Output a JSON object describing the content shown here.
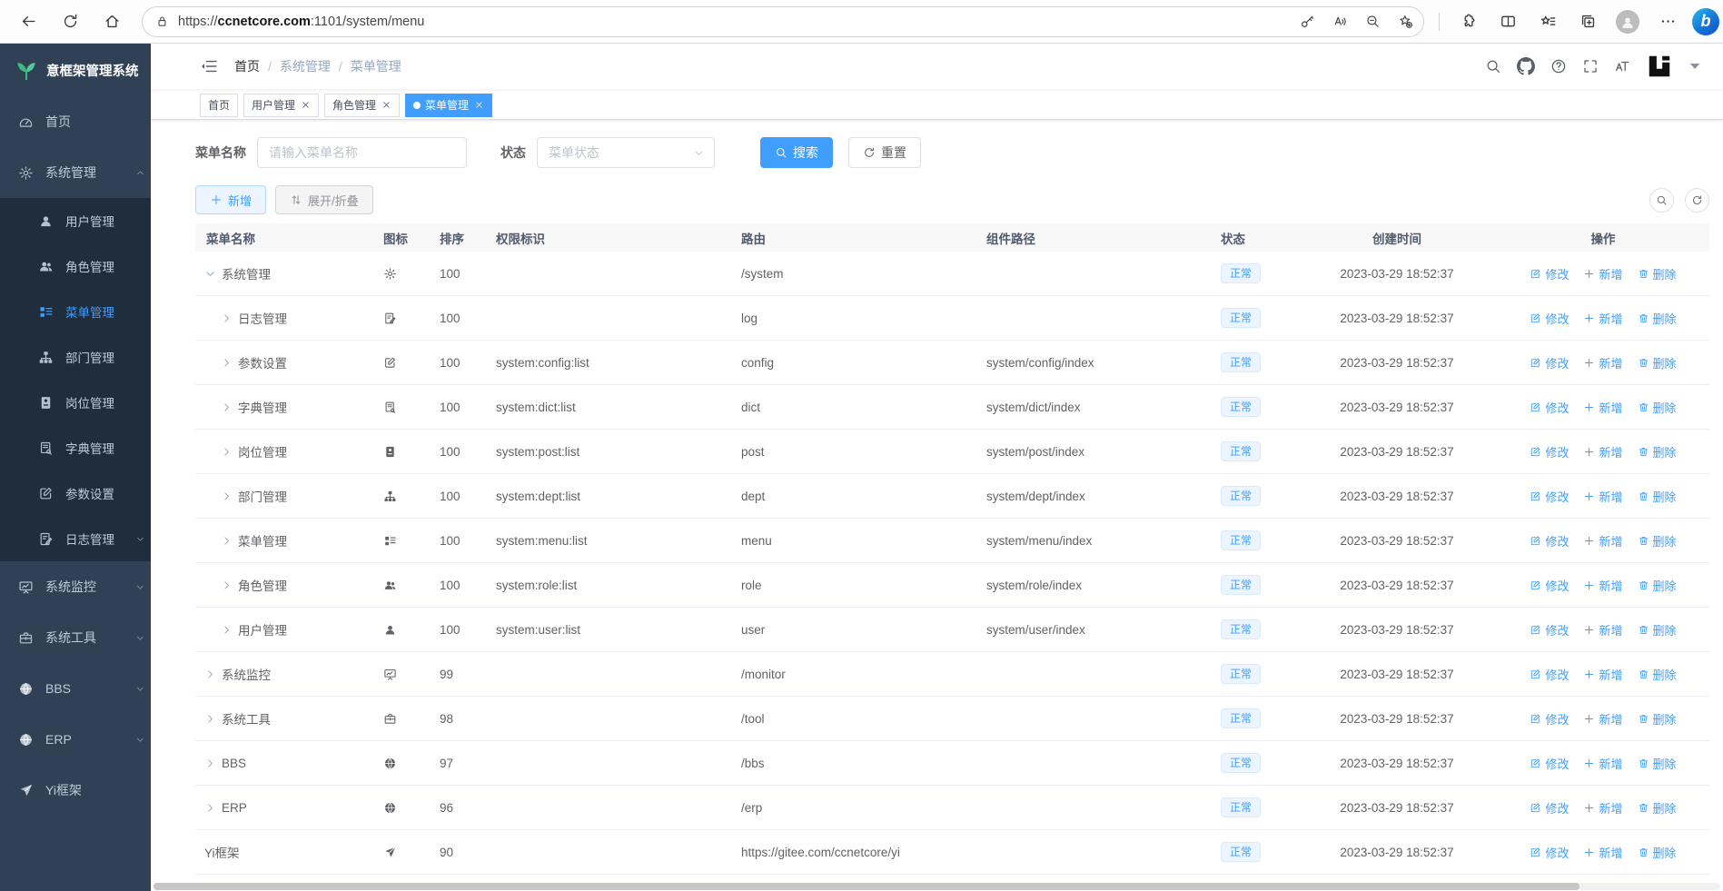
{
  "browser": {
    "url_scheme": "https://",
    "url_domain": "ccnetcore.com",
    "url_rest": ":1101/system/menu",
    "bing_label": "b"
  },
  "app": {
    "logo_text": "意框架管理系统"
  },
  "colors": {
    "accent": "#409eff",
    "sidebar_bg": "#304156",
    "sidebar_submenu_bg": "#1f2d3d",
    "active_tab_bg": "#409eff",
    "status_badge_bg": "#ecf5ff",
    "logo_green": "#3eb983"
  },
  "sidebar": {
    "items": [
      {
        "key": "home",
        "label": "首页",
        "icon": "dashboard-icon",
        "level": 0
      },
      {
        "key": "system",
        "label": "系统管理",
        "icon": "gear-icon",
        "level": 0,
        "arrow": "up"
      },
      {
        "key": "user",
        "label": "用户管理",
        "icon": "user-icon",
        "level": 1
      },
      {
        "key": "role",
        "label": "角色管理",
        "icon": "users-icon",
        "level": 1
      },
      {
        "key": "menu",
        "label": "菜单管理",
        "icon": "menu-list-icon",
        "level": 1,
        "active": true
      },
      {
        "key": "dept",
        "label": "部门管理",
        "icon": "org-tree-icon",
        "level": 1
      },
      {
        "key": "post",
        "label": "岗位管理",
        "icon": "id-badge-icon",
        "level": 1
      },
      {
        "key": "dict",
        "label": "字典管理",
        "icon": "dict-book-icon",
        "level": 1
      },
      {
        "key": "config",
        "label": "参数设置",
        "icon": "edit-square-icon",
        "level": 1
      },
      {
        "key": "log",
        "label": "日志管理",
        "icon": "log-doc-icon",
        "level": 1,
        "arrow": "down"
      },
      {
        "key": "monitor",
        "label": "系统监控",
        "icon": "monitor-icon",
        "level": 0,
        "arrow": "down"
      },
      {
        "key": "tool",
        "label": "系统工具",
        "icon": "toolbox-icon",
        "level": 0,
        "arrow": "down"
      },
      {
        "key": "bbs",
        "label": "BBS",
        "icon": "globe-icon",
        "level": 0,
        "arrow": "down"
      },
      {
        "key": "erp",
        "label": "ERP",
        "icon": "globe-icon",
        "level": 0,
        "arrow": "down"
      },
      {
        "key": "yi",
        "label": "Yi框架",
        "icon": "paper-plane-icon",
        "level": 0
      }
    ]
  },
  "breadcrumb": {
    "separator": "/",
    "items": [
      {
        "key": "home",
        "label": "首页"
      },
      {
        "key": "system",
        "label": "系统管理"
      },
      {
        "key": "menu",
        "label": "菜单管理"
      }
    ]
  },
  "tabs": [
    {
      "key": "home",
      "label": "首页",
      "closable": false,
      "active": false
    },
    {
      "key": "user",
      "label": "用户管理",
      "closable": true,
      "active": false
    },
    {
      "key": "role",
      "label": "角色管理",
      "closable": true,
      "active": false
    },
    {
      "key": "menu",
      "label": "菜单管理",
      "closable": true,
      "active": true
    }
  ],
  "filters": {
    "name_label": "菜单名称",
    "name_placeholder": "请输入菜单名称",
    "status_label": "状态",
    "status_placeholder": "菜单状态",
    "search_label": "搜索",
    "reset_label": "重置"
  },
  "toolbar": {
    "add_label": "新增",
    "expand_label": "展开/折叠"
  },
  "table": {
    "columns": [
      {
        "key": "name",
        "label": "菜单名称"
      },
      {
        "key": "icon",
        "label": "图标"
      },
      {
        "key": "sort",
        "label": "排序"
      },
      {
        "key": "perm",
        "label": "权限标识"
      },
      {
        "key": "route",
        "label": "路由"
      },
      {
        "key": "component",
        "label": "组件路径"
      },
      {
        "key": "status",
        "label": "状态"
      },
      {
        "key": "created",
        "label": "创建时间"
      },
      {
        "key": "actions",
        "label": "操作"
      }
    ],
    "row_actions": [
      {
        "key": "edit",
        "label": "修改",
        "icon": "edit-pen-icon"
      },
      {
        "key": "add",
        "label": "新增",
        "icon": "plus-icon"
      },
      {
        "key": "delete",
        "label": "删除",
        "icon": "trash-icon"
      }
    ],
    "rows": [
      {
        "name": "系统管理",
        "icon": "gear-icon",
        "level": 0,
        "caret": "down",
        "sort": "100",
        "perm": "",
        "route": "/system",
        "component": "",
        "status": "正常",
        "created": "2023-03-29 18:52:37"
      },
      {
        "name": "日志管理",
        "icon": "log-doc-icon",
        "level": 1,
        "caret": "right",
        "sort": "100",
        "perm": "",
        "route": "log",
        "component": "",
        "status": "正常",
        "created": "2023-03-29 18:52:37"
      },
      {
        "name": "参数设置",
        "icon": "edit-square-icon",
        "level": 1,
        "caret": "right",
        "sort": "100",
        "perm": "system:config:list",
        "route": "config",
        "component": "system/config/index",
        "status": "正常",
        "created": "2023-03-29 18:52:37"
      },
      {
        "name": "字典管理",
        "icon": "dict-book-icon",
        "level": 1,
        "caret": "right",
        "sort": "100",
        "perm": "system:dict:list",
        "route": "dict",
        "component": "system/dict/index",
        "status": "正常",
        "created": "2023-03-29 18:52:37"
      },
      {
        "name": "岗位管理",
        "icon": "id-badge-icon",
        "level": 1,
        "caret": "right",
        "sort": "100",
        "perm": "system:post:list",
        "route": "post",
        "component": "system/post/index",
        "status": "正常",
        "created": "2023-03-29 18:52:37"
      },
      {
        "name": "部门管理",
        "icon": "org-tree-icon",
        "level": 1,
        "caret": "right",
        "sort": "100",
        "perm": "system:dept:list",
        "route": "dept",
        "component": "system/dept/index",
        "status": "正常",
        "created": "2023-03-29 18:52:37"
      },
      {
        "name": "菜单管理",
        "icon": "menu-list-icon",
        "level": 1,
        "caret": "right",
        "sort": "100",
        "perm": "system:menu:list",
        "route": "menu",
        "component": "system/menu/index",
        "status": "正常",
        "created": "2023-03-29 18:52:37"
      },
      {
        "name": "角色管理",
        "icon": "users-icon",
        "level": 1,
        "caret": "right",
        "sort": "100",
        "perm": "system:role:list",
        "route": "role",
        "component": "system/role/index",
        "status": "正常",
        "created": "2023-03-29 18:52:37"
      },
      {
        "name": "用户管理",
        "icon": "user-icon",
        "level": 1,
        "caret": "right",
        "sort": "100",
        "perm": "system:user:list",
        "route": "user",
        "component": "system/user/index",
        "status": "正常",
        "created": "2023-03-29 18:52:37"
      },
      {
        "name": "系统监控",
        "icon": "monitor-icon",
        "level": 0,
        "caret": "right",
        "sort": "99",
        "perm": "",
        "route": "/monitor",
        "component": "",
        "status": "正常",
        "created": "2023-03-29 18:52:37"
      },
      {
        "name": "系统工具",
        "icon": "toolbox-icon",
        "level": 0,
        "caret": "right",
        "sort": "98",
        "perm": "",
        "route": "/tool",
        "component": "",
        "status": "正常",
        "created": "2023-03-29 18:52:37"
      },
      {
        "name": "BBS",
        "icon": "globe-icon",
        "level": 0,
        "caret": "right",
        "sort": "97",
        "perm": "",
        "route": "/bbs",
        "component": "",
        "status": "正常",
        "created": "2023-03-29 18:52:37"
      },
      {
        "name": "ERP",
        "icon": "globe-icon",
        "level": 0,
        "caret": "right",
        "sort": "96",
        "perm": "",
        "route": "/erp",
        "component": "",
        "status": "正常",
        "created": "2023-03-29 18:52:37"
      },
      {
        "name": "Yi框架",
        "icon": "paper-plane-icon",
        "level": 0,
        "caret": "none",
        "sort": "90",
        "perm": "",
        "route": "https://gitee.com/ccnetcore/yi",
        "component": "",
        "status": "正常",
        "created": "2023-03-29 18:52:37"
      }
    ]
  }
}
